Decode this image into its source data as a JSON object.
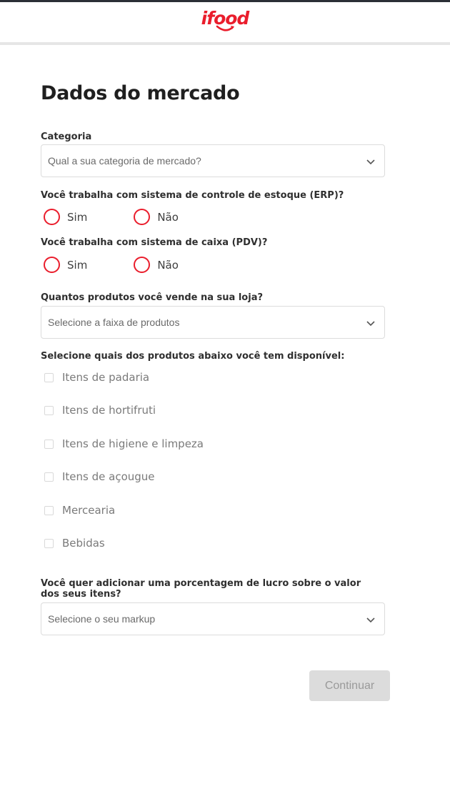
{
  "header": {
    "logo_text": "ifood",
    "brand_color": "#ea1d2c"
  },
  "page": {
    "title": "Dados do mercado"
  },
  "form": {
    "category": {
      "label": "Categoria",
      "placeholder": "Qual a sua categoria de mercado?"
    },
    "erp": {
      "label": "Você trabalha com sistema de controle de estoque (ERP)?",
      "options": [
        "Sim",
        "Não"
      ]
    },
    "pdv": {
      "label": "Você trabalha com sistema de caixa (PDV)?",
      "options": [
        "Sim",
        "Não"
      ]
    },
    "product_range": {
      "label": "Quantos produtos você vende na sua loja?",
      "placeholder": "Selecione a faixa de produtos"
    },
    "products_available": {
      "label": "Selecione quais dos produtos abaixo você tem disponível:",
      "items": [
        "Itens de padaria",
        "Itens de hortifruti",
        "Itens de higiene e limpeza",
        "Itens de açougue",
        "Mercearia",
        "Bebidas"
      ]
    },
    "markup": {
      "label": "Você quer adicionar uma porcentagem de lucro sobre o valor dos seus itens?",
      "placeholder": "Selecione o seu markup"
    },
    "continue_label": "Continuar"
  },
  "icons": {
    "select_arrow": "chevron-down-icon"
  }
}
